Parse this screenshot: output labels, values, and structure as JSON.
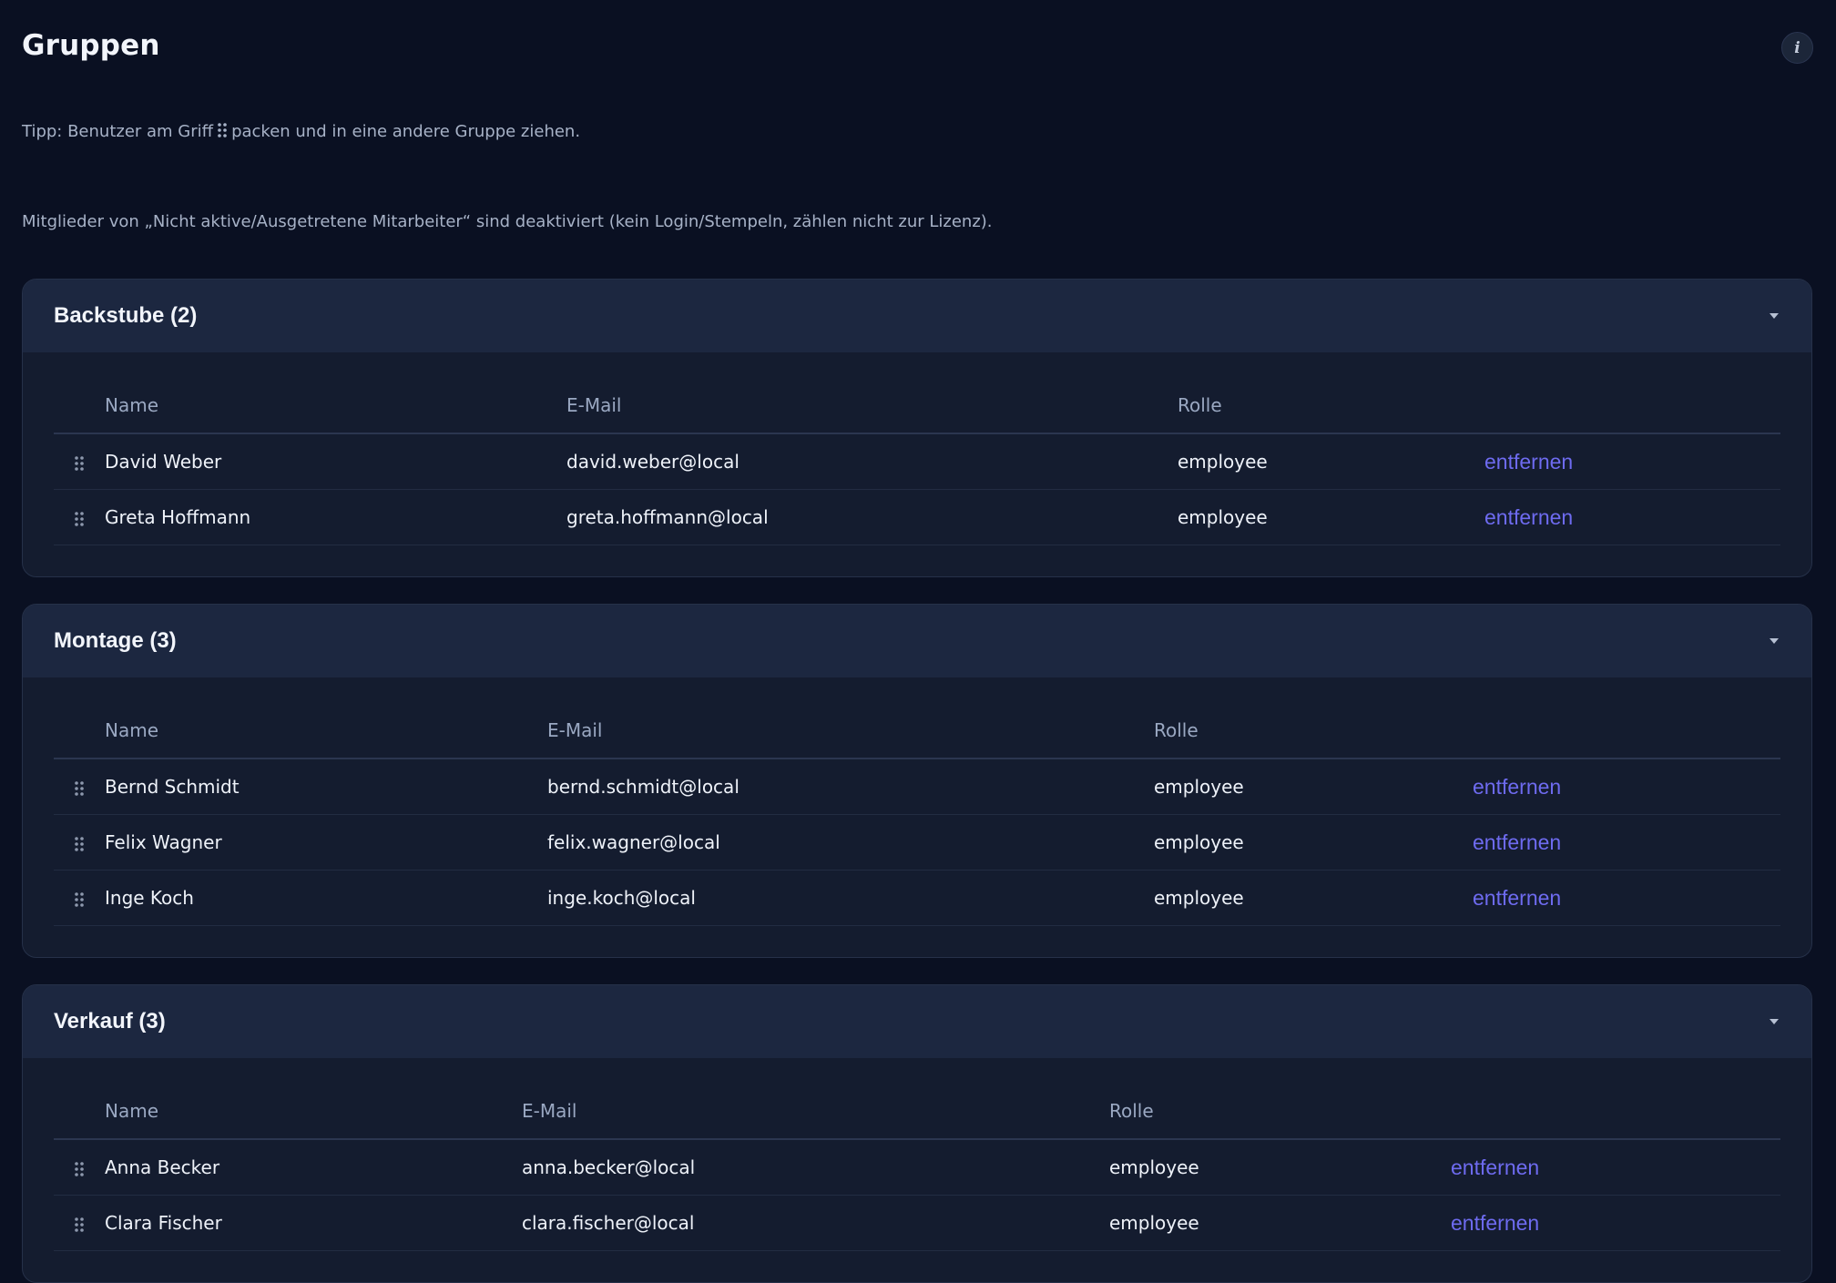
{
  "page": {
    "title": "Gruppen",
    "info_icon": "i"
  },
  "hints": {
    "tip_before": "Tipp: Benutzer am Griff",
    "tip_after": "packen und in eine andere Gruppe ziehen.",
    "deactivated": "Mitglieder von „Nicht aktive/Ausgetretene Mitarbeiter“ sind deaktiviert (kein Login/Stempeln, zählen nicht zur Lizenz)."
  },
  "table_headers": {
    "name": "Name",
    "email": "E-Mail",
    "role": "Rolle"
  },
  "groups": [
    {
      "title": "Backstube (2)",
      "members": [
        {
          "name": "David Weber",
          "email": "david.weber@local",
          "role": "employee",
          "action": "entfernen"
        },
        {
          "name": "Greta Hoffmann",
          "email": "greta.hoffmann@local",
          "role": "employee",
          "action": "entfernen"
        }
      ]
    },
    {
      "title": "Montage (3)",
      "members": [
        {
          "name": "Bernd Schmidt",
          "email": "bernd.schmidt@local",
          "role": "employee",
          "action": "entfernen"
        },
        {
          "name": "Felix Wagner",
          "email": "felix.wagner@local",
          "role": "employee",
          "action": "entfernen"
        },
        {
          "name": "Inge Koch",
          "email": "inge.koch@local",
          "role": "employee",
          "action": "entfernen"
        }
      ]
    },
    {
      "title": "Verkauf (3)",
      "members": [
        {
          "name": "Anna Becker",
          "email": "anna.becker@local",
          "role": "employee",
          "action": "entfernen"
        },
        {
          "name": "Clara Fischer",
          "email": "clara.fischer@local",
          "role": "employee",
          "action": "entfernen"
        }
      ]
    }
  ],
  "colors": {
    "background": "#0a1022",
    "card": "#141c2f",
    "card_header": "#1c2740",
    "link": "#6e6bf0"
  },
  "icons": {
    "drag_handle": "grip-vertical-icon",
    "collapse": "chevron-down-icon",
    "info": "info-icon"
  }
}
